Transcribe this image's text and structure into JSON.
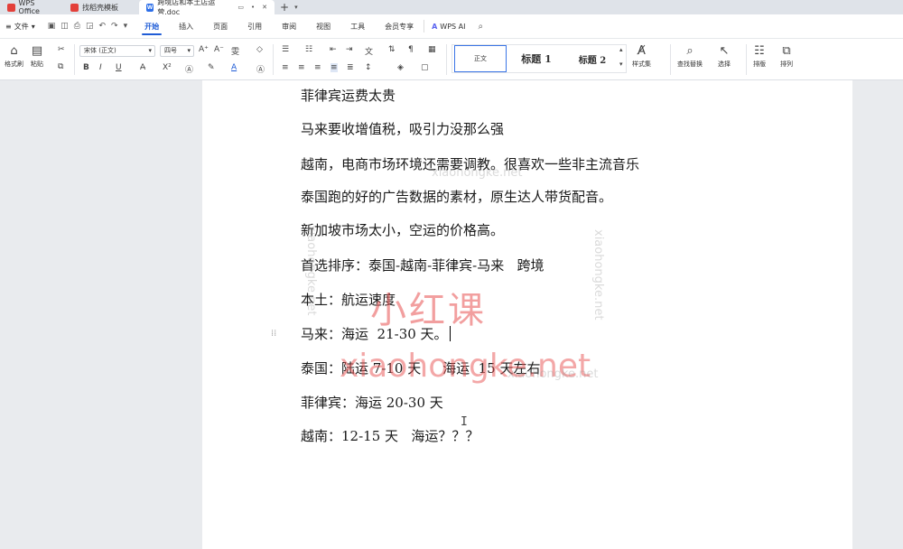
{
  "tabs": [
    {
      "label": "WPS Office"
    },
    {
      "label": "找稻壳模板"
    },
    {
      "label": "跨境店和本土店运营.doc"
    }
  ],
  "menu": {
    "file": "文件",
    "items": [
      "开始",
      "插入",
      "页面",
      "引用",
      "审阅",
      "视图",
      "工具",
      "会员专享"
    ],
    "active_index": 0,
    "ai": "WPS AI"
  },
  "ribbon": {
    "format_painter": "格式刷",
    "paste": "粘贴",
    "font_name": "宋体 (正文)",
    "font_size": "四号",
    "styles": {
      "normal": "正文",
      "h1": "标题 1",
      "h2": "标题 2"
    },
    "style_set": "样式集",
    "find_replace": "查找替换",
    "select": "选择",
    "layout": "排版",
    "arrange": "排列"
  },
  "document": {
    "paragraphs": [
      "菲律宾运费太贵",
      "马来要收增值税，吸引力没那么强",
      "越南，电商市场环境还需要调教。很喜欢一些非主流音乐",
      "泰国跑的好的广告数据的素材，原生达人带货配音。",
      "新加坡市场太小，空运的价格高。",
      "首选排序：泰国-越南-菲律宾-马来   跨境",
      "本土：航运速度",
      "马来：海运  21-30 天。",
      "泰国：陆运 7-10 天     海运  15 天左右",
      "菲律宾：海运 20-30 天",
      "越南：12-15 天   海运？？？"
    ]
  },
  "watermark": {
    "brand_cn": "小红课",
    "brand_en": "xiaohongke.net"
  }
}
